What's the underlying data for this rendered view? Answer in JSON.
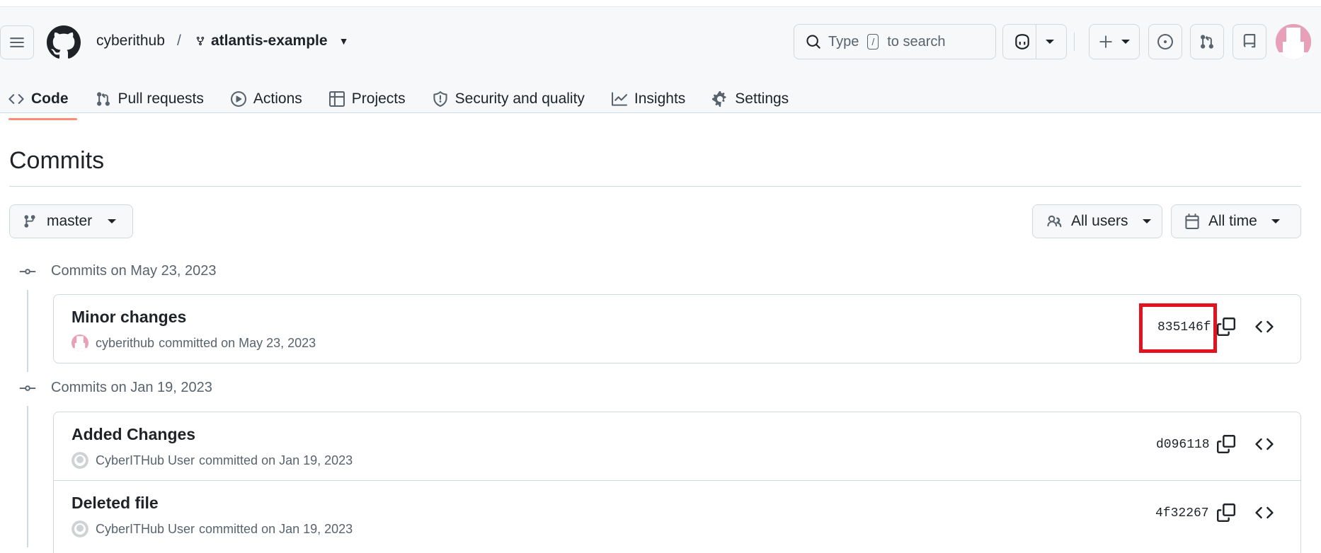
{
  "header": {
    "owner": "cyberithub",
    "separator": "/",
    "repo": "atlantis-example",
    "search_prefix": "Type",
    "search_key": "/",
    "search_suffix": "to search"
  },
  "tabs": [
    {
      "label": "Code",
      "icon": "code-icon"
    },
    {
      "label": "Pull requests",
      "icon": "pull-request-icon"
    },
    {
      "label": "Actions",
      "icon": "play-icon"
    },
    {
      "label": "Projects",
      "icon": "table-icon"
    },
    {
      "label": "Security and quality",
      "icon": "shield-icon"
    },
    {
      "label": "Insights",
      "icon": "graph-icon"
    },
    {
      "label": "Settings",
      "icon": "gear-icon"
    }
  ],
  "page": {
    "title": "Commits",
    "branch": "master",
    "users_filter": "All users",
    "time_filter": "All time"
  },
  "groups": [
    {
      "heading": "Commits on May 23, 2023",
      "commits": [
        {
          "title": "Minor changes",
          "author": "cyberithub",
          "meta": "committed on May 23, 2023",
          "sha": "835146f"
        }
      ]
    },
    {
      "heading": "Commits on Jan 19, 2023",
      "commits": [
        {
          "title": "Added Changes",
          "author": "CyberITHub User",
          "meta": "committed on Jan 19, 2023",
          "sha": "d096118"
        },
        {
          "title": "Deleted file",
          "author": "CyberITHub User",
          "meta": "committed on Jan 19, 2023",
          "sha": "4f32267"
        }
      ]
    }
  ],
  "colors": {
    "accent_tab": "#fd8c73",
    "highlight": "#e0131e",
    "avatar_pink": "#e8a0b8"
  }
}
